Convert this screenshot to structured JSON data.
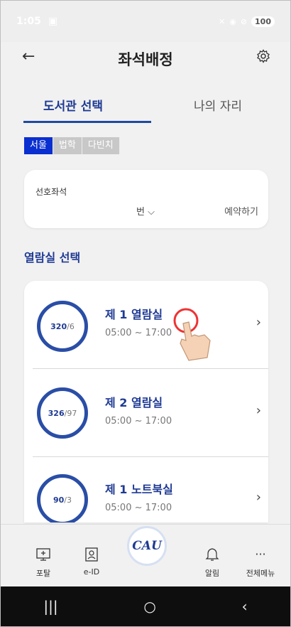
{
  "status": {
    "time": "1:05",
    "battery": "100"
  },
  "header": {
    "title": "좌석배정"
  },
  "tabs": [
    {
      "label": "도서관 선택",
      "active": true
    },
    {
      "label": "나의 자리",
      "active": false
    }
  ],
  "campus": [
    {
      "label": "서울",
      "active": true
    },
    {
      "label": "법학",
      "active": false
    },
    {
      "label": "다빈치",
      "active": false
    }
  ],
  "preferred": {
    "label": "선호좌석",
    "seat_suffix": "번",
    "reserve_label": "예약하기"
  },
  "section_title": "열람실 선택",
  "rooms": [
    {
      "name": "제 1 열람실",
      "total": "320",
      "sep": "/",
      "avail": "6",
      "hours": "05:00 ~ 17:00"
    },
    {
      "name": "제 2 열람실",
      "total": "326",
      "sep": "/",
      "avail": "97",
      "hours": "05:00 ~ 17:00"
    },
    {
      "name": "제 1 노트북실",
      "total": "90",
      "sep": "/",
      "avail": "3",
      "hours": "05:00 ~ 17:00"
    }
  ],
  "nav": {
    "portal": "포탈",
    "eid": "e-ID",
    "center_logo": "CAU",
    "alerts": "알림",
    "menu": "전체메뉴"
  },
  "colors": {
    "accent": "#1f3a93",
    "chip_active": "#0a2fd0"
  }
}
